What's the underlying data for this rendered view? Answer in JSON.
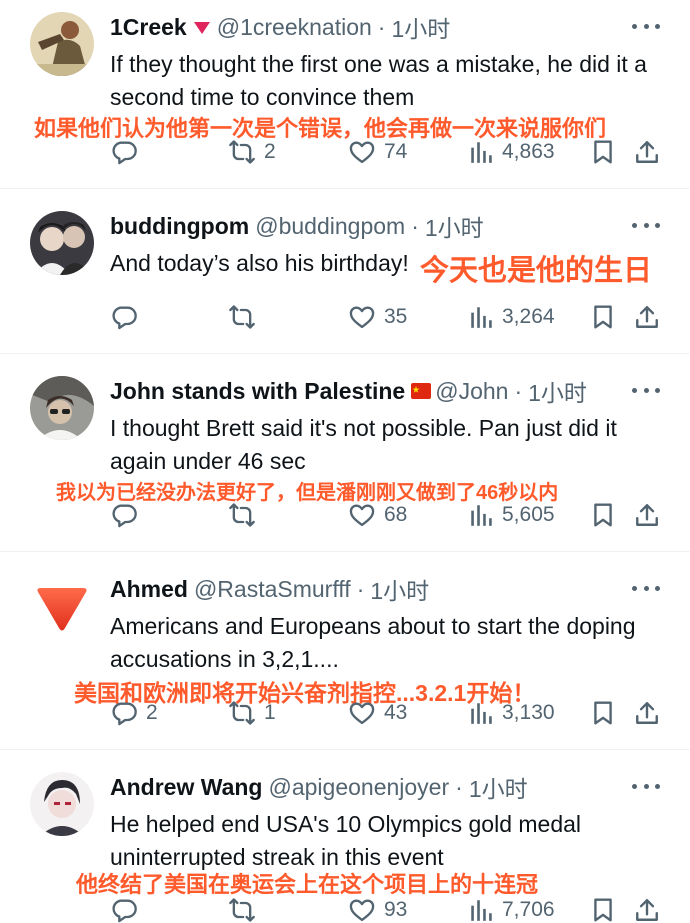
{
  "tweets": [
    {
      "name": "1Creek",
      "handle": "@1creeknation",
      "time": "1小时",
      "text": "If they thought the first one was a mistake, he did it a second time to convince them",
      "translation": "如果他们认为他第一次是个错误，他会再做一次来说服你们",
      "replies": "",
      "reposts": "2",
      "likes": "74",
      "views": "4,863"
    },
    {
      "name": "buddingpom",
      "handle": "@buddingpom",
      "time": "1小时",
      "text": "And today’s also his birthday!",
      "translation": "今天也是他的生日",
      "replies": "",
      "reposts": "",
      "likes": "35",
      "views": "3,264"
    },
    {
      "name": "John stands with Palestine",
      "handle": "@John",
      "time": "1小时",
      "text": "I thought Brett said it's not possible. Pan just did it again under 46 sec",
      "translation": "我以为已经没办法更好了，但是潘刚刚又做到了46秒以内",
      "replies": "",
      "reposts": "",
      "likes": "68",
      "views": "5,605"
    },
    {
      "name": "Ahmed",
      "handle": "@RastaSmurfff",
      "time": "1小时",
      "text": "Americans and Europeans about to start the doping accusations in 3,2,1....",
      "translation": "美国和欧洲即将开始兴奋剂指控...3.2.1开始！",
      "replies": "2",
      "reposts": "1",
      "likes": "43",
      "views": "3,130"
    },
    {
      "name": "Andrew Wang",
      "handle": "@apigeonenjoyer",
      "time": "1小时",
      "text": "He helped end USA's 10 Olympics gold medal uninterrupted streak in this event",
      "translation": "他终结了美国在奥运会上在这个项目上的十连冠",
      "replies": "",
      "reposts": "",
      "likes": "93",
      "views": "7,706"
    }
  ],
  "colors": {
    "text": "#0f1419",
    "muted": "#536471",
    "annotation": "#ff5a2c",
    "divider": "#eff3f4",
    "downvote": "#e0245e"
  },
  "icons": [
    "reply-icon",
    "repost-icon",
    "like-icon",
    "views-icon",
    "bookmark-icon",
    "share-icon",
    "more-icon"
  ]
}
